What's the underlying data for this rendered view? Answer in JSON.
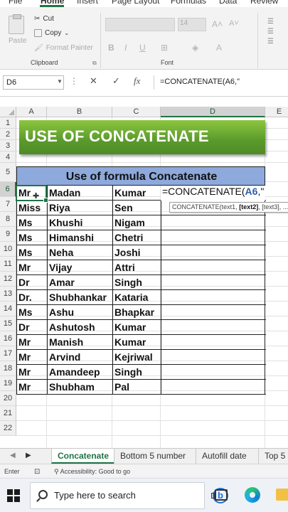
{
  "ribbon": {
    "menu": [
      {
        "label": "File",
        "active": false
      },
      {
        "label": "Home",
        "active": true
      },
      {
        "label": "Insert",
        "active": false
      },
      {
        "label": "Page Layout",
        "active": false
      },
      {
        "label": "Formulas",
        "active": false
      },
      {
        "label": "Data",
        "active": false
      },
      {
        "label": "Review",
        "active": false
      }
    ],
    "paste_label": "Paste",
    "cut_label": "Cut",
    "copy_label": "Copy",
    "format_painter_label": "Format Painter",
    "clipboard_group": "Clipboard",
    "font_size": "14",
    "font_group": "Font"
  },
  "formula_bar": {
    "name_box": "D6",
    "fx_label": "fx",
    "formula": "=CONCATENATE(A6,\""
  },
  "columns": [
    "A",
    "B",
    "C",
    "D",
    "E"
  ],
  "selected_column": "D",
  "rows": [
    "1",
    "2",
    "3",
    "4",
    "5",
    "6",
    "7",
    "8",
    "9",
    "10",
    "11",
    "12",
    "13",
    "14",
    "15",
    "16",
    "17",
    "18",
    "19",
    "20",
    "21",
    "22"
  ],
  "selected_row": "6",
  "banner": {
    "text": "USE OF CONCATENATE",
    "color": "#6aa936"
  },
  "table": {
    "title": "Use of formula Concatenate",
    "title_bg": "#8ea9db",
    "rows": [
      [
        "Mr",
        "Madan",
        "Kumar"
      ],
      [
        "Miss",
        "Riya",
        "Sen"
      ],
      [
        "Ms",
        "Khushi",
        "Nigam"
      ],
      [
        "Ms",
        "Himanshi",
        "Chetri"
      ],
      [
        "Ms",
        "Neha",
        "Joshi"
      ],
      [
        "Mr",
        "Vijay",
        "Attri"
      ],
      [
        "Dr",
        "Amar",
        "Singh"
      ],
      [
        "Dr.",
        "Shubhankar",
        "Kataria"
      ],
      [
        "Ms",
        "Ashu",
        "Bhapkar"
      ],
      [
        "Dr",
        "Ashutosh",
        "Kumar"
      ],
      [
        "Mr",
        "Manish",
        "Kumar"
      ],
      [
        "Mr",
        "Arvind",
        "Kejriwal"
      ],
      [
        "Mr",
        "Amandeep",
        "Singh"
      ],
      [
        "Mr",
        "Shubham",
        "Pal"
      ]
    ]
  },
  "edit_cell": {
    "prefix": "=CONCATENATE(",
    "ref": "A6",
    "suffix": ",\""
  },
  "tooltip": {
    "fn": "CONCATENATE(text1, ",
    "arg": "[text2]",
    "rest": ", [text3], ...)"
  },
  "sheet_tabs": [
    {
      "label": "Concatenate",
      "active": true
    },
    {
      "label": "Bottom 5 number",
      "active": false
    },
    {
      "label": "Autofill date",
      "active": false
    },
    {
      "label": "Top 5",
      "active": false
    }
  ],
  "status": {
    "mode": "Enter",
    "accessibility": "Accessibility: Good to go"
  },
  "taskbar": {
    "search_placeholder": "Type here to search"
  },
  "colors": {
    "excel_green": "#217346",
    "accent_blue": "#2e5fa8"
  }
}
